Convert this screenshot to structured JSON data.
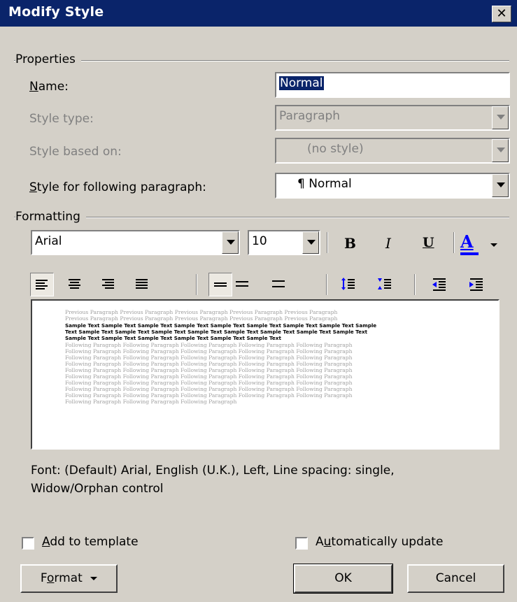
{
  "dialog": {
    "title": "Modify Style",
    "close_glyph": "✕"
  },
  "properties": {
    "group_label": "Properties",
    "name_label": "Name:",
    "name_value": "Normal",
    "style_type_label": "Style type:",
    "style_type_value": "Paragraph",
    "based_on_label": "Style based on:",
    "based_on_value": "(no style)",
    "following_label": "Style for following paragraph:",
    "following_value": "¶ Normal"
  },
  "formatting": {
    "group_label": "Formatting",
    "font": "Arial",
    "size": "10",
    "bold": "B",
    "italic": "I",
    "underline": "U",
    "font_color_glyph": "A",
    "alignments": [
      "align-left",
      "align-center",
      "align-right",
      "justify"
    ],
    "line_spacing": [
      "single",
      "one-and-half",
      "double"
    ],
    "paragraph_spacing": [
      "increase-spacing",
      "decrease-spacing"
    ],
    "indent": [
      "decrease-indent",
      "increase-indent"
    ],
    "colors": {
      "font_color_bar": "#0000ff",
      "selection": "#0a246a"
    }
  },
  "preview": {
    "previous_line": "Previous Paragraph Previous Paragraph Previous Paragraph Previous Paragraph Previous Paragraph",
    "sample_line1": "Sample Text Sample Text Sample Text Sample Text Sample Text Sample Text Sample Text Sample Text Sample",
    "sample_line2": "Text Sample Text Sample Text Sample Text Sample Text Sample Text Sample Text Sample Text Sample Text",
    "sample_line3": "Sample Text Sample Text Sample Text Sample Text Sample Text Sample Text",
    "following_line": "Following Paragraph Following Paragraph Following Paragraph Following Paragraph Following Paragraph",
    "following_last": "Following Paragraph Following Paragraph Following Paragraph"
  },
  "description": {
    "line1": "Font: (Default) Arial, English (U.K.), Left, Line spacing:  single,",
    "line2": "Widow/Orphan control"
  },
  "footer": {
    "add_to_template": "Add to template",
    "auto_update": "Automatically update",
    "format_button": "Format",
    "ok_button": "OK",
    "cancel_button": "Cancel"
  }
}
